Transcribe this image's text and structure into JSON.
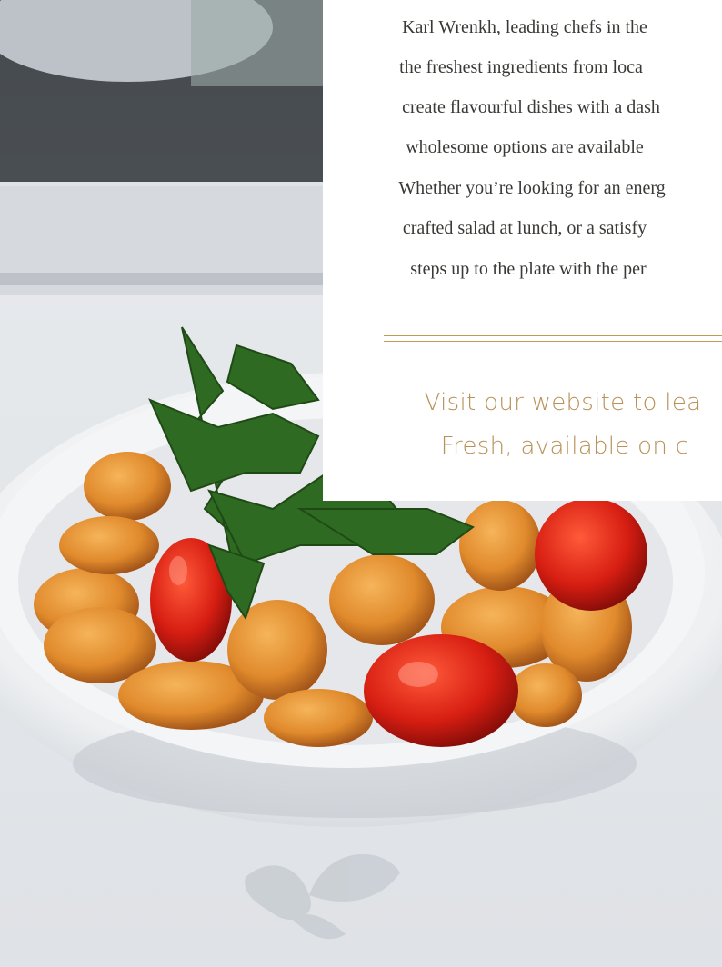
{
  "body_text": {
    "lines": [
      "Karl Wrenkh, leading chefs in the",
      "the freshest ingredients from loca",
      "create flavourful dishes with a dash",
      "wholesome options are available",
      "Whether you’re looking for an energ",
      "crafted salad at lunch, or a satisfy",
      "steps up to the plate with the per"
    ]
  },
  "call_to_action": {
    "lines": [
      "Visit our website to lea",
      "Fresh, available on c"
    ]
  },
  "colors": {
    "accent_gold": "#c29a57",
    "body_text": "#3b3936",
    "panel_background": "#ffffff"
  }
}
